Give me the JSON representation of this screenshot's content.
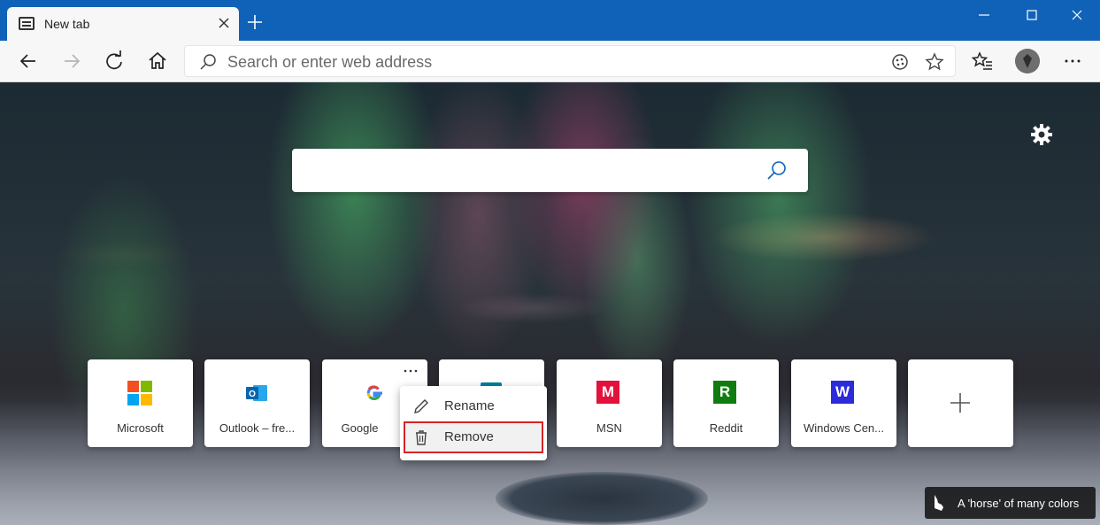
{
  "tab": {
    "title": "New tab"
  },
  "toolbar": {
    "address_placeholder": "Search or enter web address"
  },
  "newtab": {
    "tiles": [
      {
        "label": "Microsoft"
      },
      {
        "label": "Outlook – fre..."
      },
      {
        "label": "Google"
      },
      {
        "label": ""
      },
      {
        "label": "MSN",
        "letter": "M",
        "color": "#e3113b"
      },
      {
        "label": "Reddit",
        "letter": "R",
        "color": "#107c10"
      },
      {
        "label": "Windows Cen...",
        "letter": "W",
        "color": "#2b2bdb"
      },
      {
        "label": ""
      }
    ],
    "context_menu": {
      "rename": "Rename",
      "remove": "Remove"
    },
    "background_credit": "A 'horse' of many colors"
  },
  "colors": {
    "titlebar": "#0f62b8",
    "highlight_border": "#d6242a"
  }
}
